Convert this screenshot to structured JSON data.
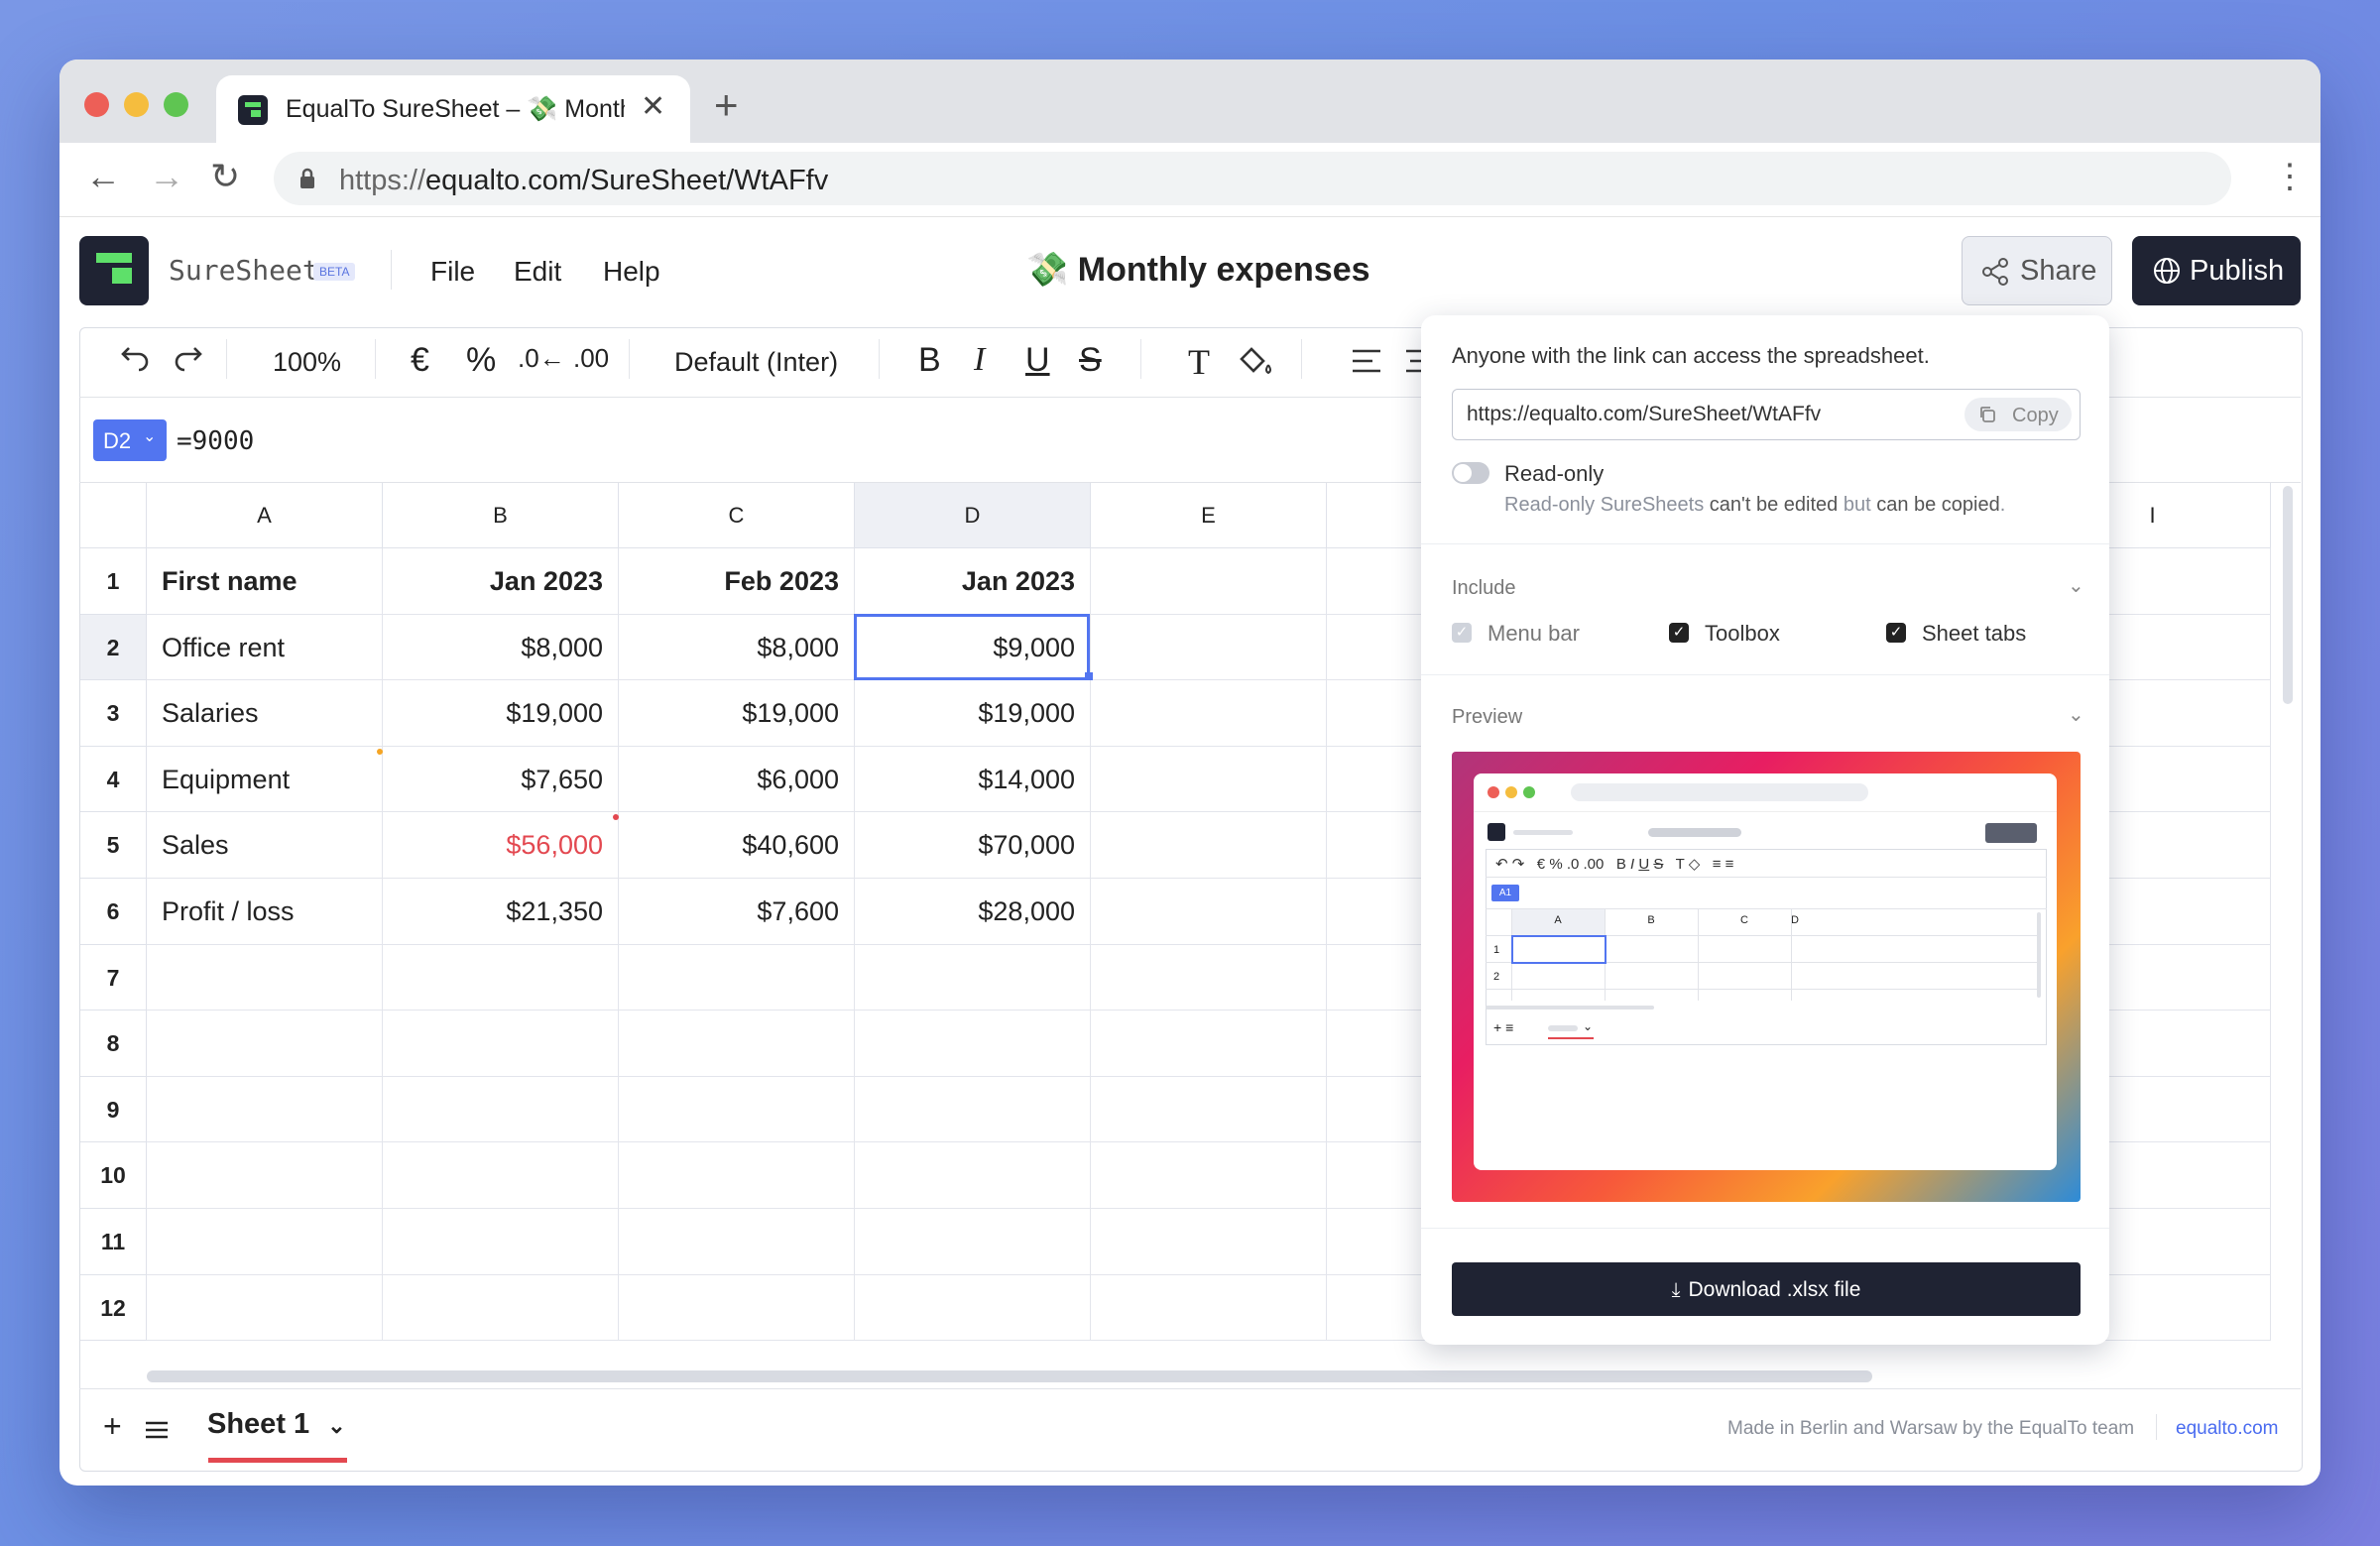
{
  "browser": {
    "tab_title": "EqualTo SureSheet – 💸 Monthly expenses",
    "url_scheme": "https://",
    "url_rest": "equalto.com/SureSheet/WtAFfv",
    "new_tab_icon": "plus-icon"
  },
  "app": {
    "brand": "SureSheet",
    "beta": "BETA",
    "menu": [
      "File",
      "Edit",
      "Help"
    ],
    "doc_title": "💸 Monthly expenses",
    "share_label": "Share",
    "publish_label": "Publish"
  },
  "toolbar": {
    "zoom": "100%",
    "font": "Default (Inter)",
    "currency_symbol": "€",
    "percent_symbol": "%",
    "bold": "B",
    "italic": "I",
    "underline": "U",
    "strike": "S",
    "text_format": "T"
  },
  "formula_bar": {
    "cell_ref": "D2",
    "formula": "=9000"
  },
  "grid": {
    "columns": [
      "A",
      "B",
      "C",
      "D",
      "E",
      "",
      "",
      "",
      "I"
    ],
    "rows": [
      {
        "num": "1",
        "cells": [
          "First name",
          "Jan 2023",
          "Feb 2023",
          "Jan 2023"
        ]
      },
      {
        "num": "2",
        "cells": [
          "Office rent",
          "$8,000",
          "$8,000",
          "$9,000"
        ]
      },
      {
        "num": "3",
        "cells": [
          "Salaries",
          "$19,000",
          "$19,000",
          "$19,000"
        ]
      },
      {
        "num": "4",
        "cells": [
          "Equipment",
          "$7,650",
          "$6,000",
          "$14,000"
        ]
      },
      {
        "num": "5",
        "cells": [
          "Sales",
          "$56,000",
          "$40,600",
          "$70,000"
        ]
      },
      {
        "num": "6",
        "cells": [
          "Profit / loss",
          "$21,350",
          "$7,600",
          "$28,000"
        ]
      },
      {
        "num": "7",
        "cells": [
          "",
          "",
          "",
          ""
        ]
      },
      {
        "num": "8",
        "cells": [
          "",
          "",
          "",
          ""
        ]
      },
      {
        "num": "9",
        "cells": [
          "",
          "",
          "",
          ""
        ]
      },
      {
        "num": "10",
        "cells": [
          "",
          "",
          "",
          ""
        ]
      },
      {
        "num": "11",
        "cells": [
          "",
          "",
          "",
          ""
        ]
      },
      {
        "num": "12",
        "cells": [
          "",
          "",
          "",
          ""
        ]
      }
    ],
    "selected_cell": "D2",
    "negative_color": "#e34850",
    "selection_color": "#5275f0"
  },
  "sheets": {
    "active": "Sheet 1"
  },
  "footer": {
    "credit": "Made in Berlin and Warsaw by the EqualTo team",
    "link": "equalto.com"
  },
  "share_popup": {
    "info": "Anyone with the link can access the spreadsheet.",
    "link": "https://equalto.com/SureSheet/WtAFfv",
    "copy": "Copy",
    "readonly_label": "Read-only",
    "readonly_note_1": "Read-only SureSheets ",
    "readonly_note_2": "can't be edited",
    "readonly_note_3": " but ",
    "readonly_note_4": "can be copied",
    "readonly_note_5": ".",
    "include_title": "Include",
    "include_items": [
      {
        "label": "Menu bar",
        "checked": true,
        "disabled": true
      },
      {
        "label": "Toolbox",
        "checked": true,
        "disabled": false
      },
      {
        "label": "Sheet tabs",
        "checked": true,
        "disabled": false
      }
    ],
    "preview_title": "Preview",
    "preview_labels": {
      "cell_ref": "A1",
      "cols": [
        "A",
        "B",
        "C",
        "D"
      ],
      "rows": [
        "1",
        "2"
      ]
    },
    "download": "Download .xlsx file"
  }
}
